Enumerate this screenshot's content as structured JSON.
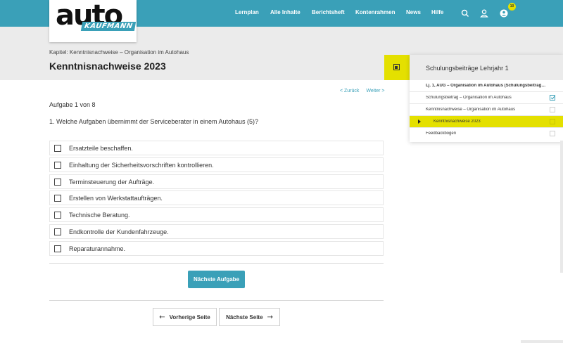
{
  "brand": {
    "logo_main": "auto",
    "logo_sub": "KAUFMANN",
    "accent": "#3aa0b8",
    "highlight": "#e4e000"
  },
  "nav": {
    "items": [
      "Lernplan",
      "Alle Inhalte",
      "Berichtsheft",
      "Kontenrahmen",
      "News",
      "Hilfe"
    ],
    "notification_count": "10",
    "icons": [
      "search-icon",
      "user-icon",
      "notification-icon"
    ]
  },
  "header": {
    "chapter": "Kapitel: Kenntnisnachweise – Organisation im Autohaus",
    "title": "Kenntnisnachweise 2023"
  },
  "main": {
    "back_link": "< Zurück",
    "forward_link": "Weiter >",
    "task_count": "Aufgabe 1 von 8",
    "question": "1. Welche Aufgaben übernimmt der Serviceberater in einem Autohaus (5)?",
    "answers": [
      "Ersatzteile beschaffen.",
      "Einhaltung der Sicherheitsvorschriften kontrollieren.",
      "Terminsteuerung der Aufträge.",
      "Erstellen von Werkstattaufträgen.",
      "Technische Beratung.",
      "Endkontrolle der Kundenfahrzeuge.",
      "Reparaturannahme."
    ],
    "next_task_label": "Nächste Aufgabe",
    "prev_page_label": "Vorherige Seite",
    "next_page_label": "Nächste Seite"
  },
  "panel": {
    "title": "Schulungsbeiträge Lehrjahr 1",
    "rows": [
      {
        "label": "Lj. 1, AUG – Organisation im Autohaus (Schulungsbeitrag…",
        "bold": true,
        "checkbox": false,
        "checked": false,
        "active": false
      },
      {
        "label": "Schulungsbeitrag – Organisation im Autohaus",
        "bold": false,
        "checkbox": true,
        "checked": true,
        "active": false
      },
      {
        "label": "Kenntnisnachweise – Organisation im Autohaus",
        "bold": false,
        "checkbox": true,
        "checked": false,
        "active": false
      },
      {
        "label": "Kenntnisnachweise 2023",
        "bold": false,
        "checkbox": true,
        "checked": false,
        "active": true
      },
      {
        "label": "Feedbackbogen",
        "bold": false,
        "checkbox": true,
        "checked": false,
        "active": false
      }
    ]
  }
}
